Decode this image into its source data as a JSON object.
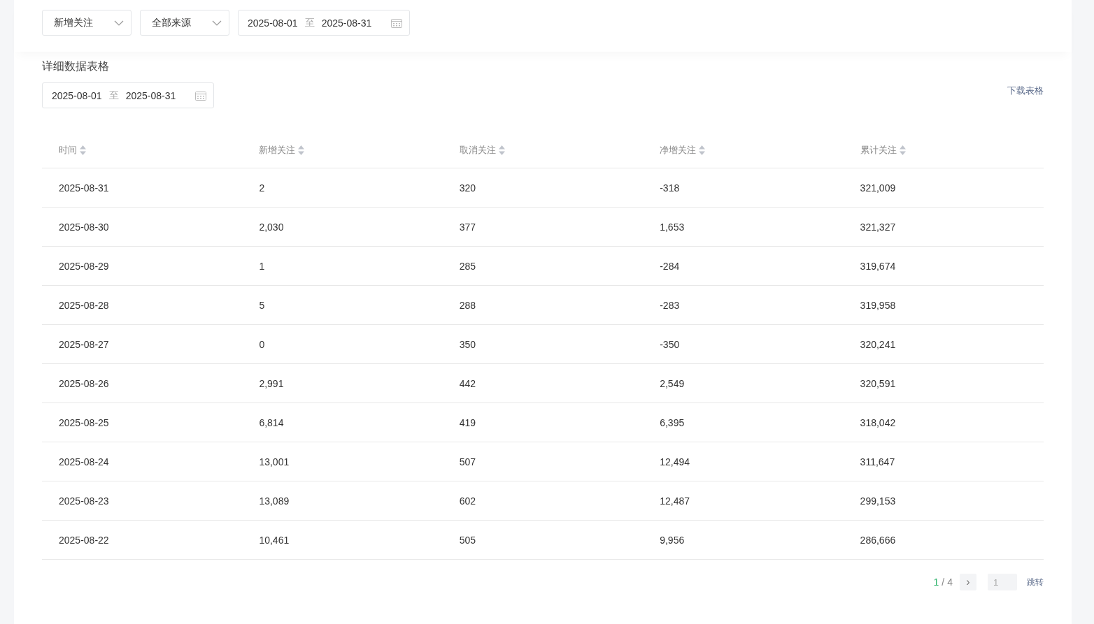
{
  "filters": {
    "metric_select": {
      "value": "新增关注"
    },
    "source_select": {
      "value": "全部来源"
    },
    "date_range": {
      "start": "2025-08-01",
      "separator": "至",
      "end": "2025-08-31"
    }
  },
  "section": {
    "title": "详细数据表格",
    "date_range": {
      "start": "2025-08-01",
      "separator": "至",
      "end": "2025-08-31"
    },
    "download_link": "下载表格"
  },
  "table": {
    "columns": [
      "时间",
      "新增关注",
      "取消关注",
      "净增关注",
      "累计关注"
    ],
    "rows": [
      [
        "2025-08-31",
        "2",
        "320",
        "-318",
        "321,009"
      ],
      [
        "2025-08-30",
        "2,030",
        "377",
        "1,653",
        "321,327"
      ],
      [
        "2025-08-29",
        "1",
        "285",
        "-284",
        "319,674"
      ],
      [
        "2025-08-28",
        "5",
        "288",
        "-283",
        "319,958"
      ],
      [
        "2025-08-27",
        "0",
        "350",
        "-350",
        "320,241"
      ],
      [
        "2025-08-26",
        "2,991",
        "442",
        "2,549",
        "320,591"
      ],
      [
        "2025-08-25",
        "6,814",
        "419",
        "6,395",
        "318,042"
      ],
      [
        "2025-08-24",
        "13,001",
        "507",
        "12,494",
        "311,647"
      ],
      [
        "2025-08-23",
        "13,089",
        "602",
        "12,487",
        "299,153"
      ],
      [
        "2025-08-22",
        "10,461",
        "505",
        "9,956",
        "286,666"
      ]
    ]
  },
  "pagination": {
    "current": "1",
    "separator": "/",
    "total": "4",
    "next": "›",
    "jump_placeholder": "1",
    "jump_button": "跳转"
  }
}
